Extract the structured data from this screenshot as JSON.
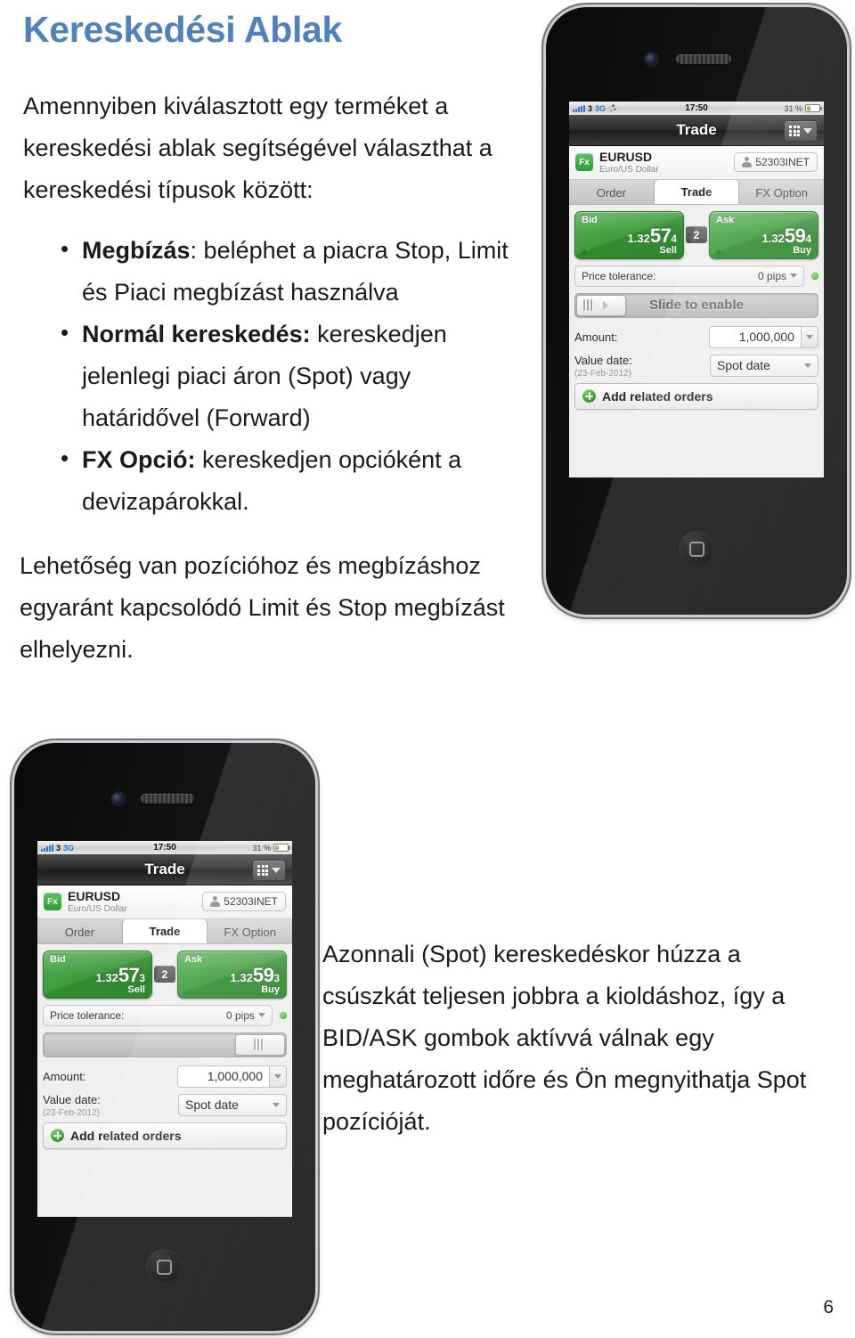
{
  "document": {
    "title": "Kereskedési Ablak",
    "intro": "Amennyiben kiválasztott egy terméket a kereskedési ablak segítségével választhat a kereskedési típusok között:",
    "bullets": [
      {
        "lead": "Megbízás",
        "sep": ":",
        "rest": " beléphet a piacra Stop, Limit és Piaci megbízást használva"
      },
      {
        "lead": "Normál kereskedés:",
        "sep": "",
        "rest": " kereskedjen jelenlegi piaci áron (Spot) vagy határidővel (Forward)"
      },
      {
        "lead": "FX Opció:",
        "sep": "",
        "rest": " kereskedjen opcióként a devizapárokkal."
      }
    ],
    "paragraph_middle": "Lehetőség van pozícióhoz és megbízáshoz egyaránt kapcsolódó Limit és Stop megbízást elhelyezni.",
    "paragraph_bottom": "Azonnali (Spot) kereskedéskor húzza a csúszkát teljesen jobbra a kioldáshoz, így a BID/ASK gombok aktívvá válnak egy meghatározott időre és Ön megnyithatja Spot pozícióját.",
    "page_number": "6",
    "title_color": "#4f81bd"
  },
  "phone_top": {
    "status_bar": {
      "carrier": "3",
      "network": "3G",
      "time": "17:50",
      "battery_percent": "31 %",
      "battery_level": 31
    },
    "nav": {
      "title": "Trade",
      "grid_icon": "grid-icon",
      "chevron_icon": "chevron-down-icon"
    },
    "instrument": {
      "badge": "Fx",
      "symbol": "EURUSD",
      "description": "Euro/US Dollar",
      "account": "52303INET"
    },
    "tabs": [
      {
        "label": "Order",
        "active": false
      },
      {
        "label": "Trade",
        "active": true
      },
      {
        "label": "FX Option",
        "active": false
      }
    ],
    "bid": {
      "label": "Bid",
      "pre": "1.32",
      "big": "57",
      "post": "4",
      "action": "Sell"
    },
    "spread": "2",
    "ask": {
      "label": "Ask",
      "pre": "1.32",
      "big": "59",
      "post": "4",
      "action": "Buy"
    },
    "tolerance": {
      "label": "Price tolerance:",
      "value": "0 pips"
    },
    "slider": {
      "text": "Slide to enable",
      "position": "left"
    },
    "amount": {
      "label": "Amount:",
      "value": "1,000,000"
    },
    "value_date": {
      "label": "Value date:",
      "sub": "(23-Feb-2012)",
      "value": "Spot date"
    },
    "add_orders": "Add related orders"
  },
  "phone_bottom": {
    "status_bar": {
      "carrier": "3",
      "network": "3G",
      "time": "17:50",
      "battery_percent": "31 %",
      "battery_level": 31
    },
    "nav": {
      "title": "Trade",
      "grid_icon": "grid-icon",
      "chevron_icon": "chevron-down-icon"
    },
    "instrument": {
      "badge": "Fx",
      "symbol": "EURUSD",
      "description": "Euro/US Dollar",
      "account": "52303INET"
    },
    "tabs": [
      {
        "label": "Order",
        "active": false
      },
      {
        "label": "Trade",
        "active": true
      },
      {
        "label": "FX Option",
        "active": false
      }
    ],
    "bid": {
      "label": "Bid",
      "pre": "1.32",
      "big": "57",
      "post": "3",
      "action": "Sell"
    },
    "spread": "2",
    "ask": {
      "label": "Ask",
      "pre": "1.32",
      "big": "59",
      "post": "3",
      "action": "Buy"
    },
    "tolerance": {
      "label": "Price tolerance:",
      "value": "0 pips"
    },
    "slider": {
      "text": "",
      "position": "right"
    },
    "amount": {
      "label": "Amount:",
      "value": "1,000,000"
    },
    "value_date": {
      "label": "Value date:",
      "sub": "(23-Feb-2012)",
      "value": "Spot date"
    },
    "add_orders": "Add related orders"
  }
}
